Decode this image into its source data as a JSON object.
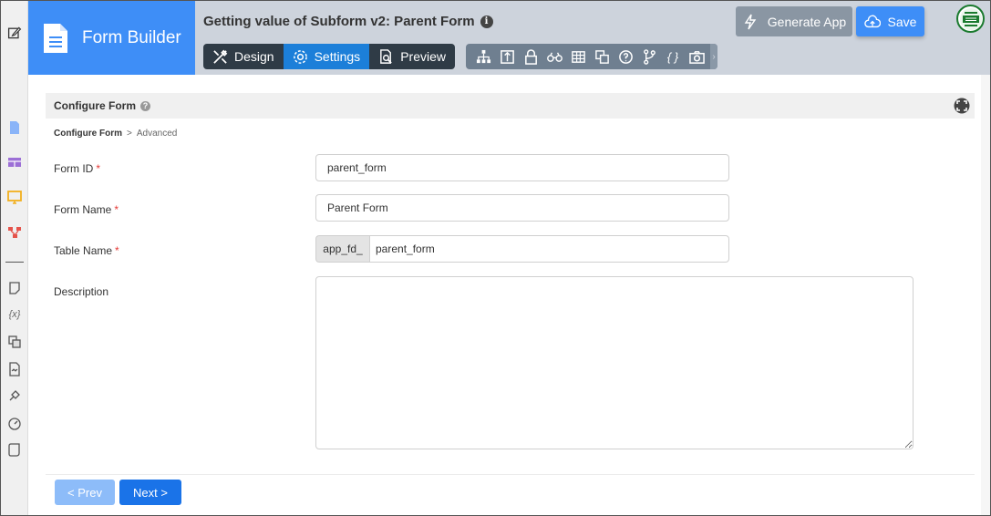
{
  "colors": {
    "brand_blue": "#3e8ef7",
    "header_gray": "#cdd3dc",
    "active_tab": "#1c7fd9",
    "required": "#e53935",
    "next_button": "#1a73e8"
  },
  "rail": {
    "icons": [
      "edit-icon",
      "file-icon",
      "table-icon",
      "monitor-icon",
      "flow-icon",
      "note-icon",
      "variable-icon",
      "translate-icon",
      "document-icon",
      "plugin-icon",
      "dashboard-icon",
      "script-icon"
    ],
    "variable_glyph": "{x}"
  },
  "header": {
    "brand_title": "Form Builder",
    "form_title": "Getting value of Subform v2: Parent Form",
    "info_glyph": "i",
    "tabs": [
      {
        "label": "Design",
        "icon": "design-icon"
      },
      {
        "label": "Settings",
        "icon": "gear-icon"
      },
      {
        "label": "Preview",
        "icon": "preview-icon"
      }
    ],
    "tools": [
      "sitemap-icon",
      "layout-icon",
      "lock-icon",
      "binoculars-icon",
      "grid-icon",
      "translate-icon",
      "question-icon",
      "branch-icon",
      "code-icon",
      "camera-icon"
    ],
    "code_glyph": "{ }",
    "generate_label": "Generate App",
    "save_label": "Save"
  },
  "section": {
    "title": "Configure Form",
    "help_glyph": "?"
  },
  "breadcrumb": {
    "current": "Configure Form",
    "separator": ">",
    "next": "Advanced"
  },
  "fields": {
    "form_id": {
      "label": "Form ID",
      "value": "parent_form",
      "required": "*"
    },
    "form_name": {
      "label": "Form Name",
      "value": "Parent Form",
      "required": "*"
    },
    "table_name": {
      "label": "Table Name",
      "prefix": "app_fd_",
      "value": "parent_form",
      "required": "*"
    },
    "description": {
      "label": "Description",
      "value": ""
    }
  },
  "footer": {
    "prev_label": "< Prev",
    "next_label": "Next >"
  }
}
